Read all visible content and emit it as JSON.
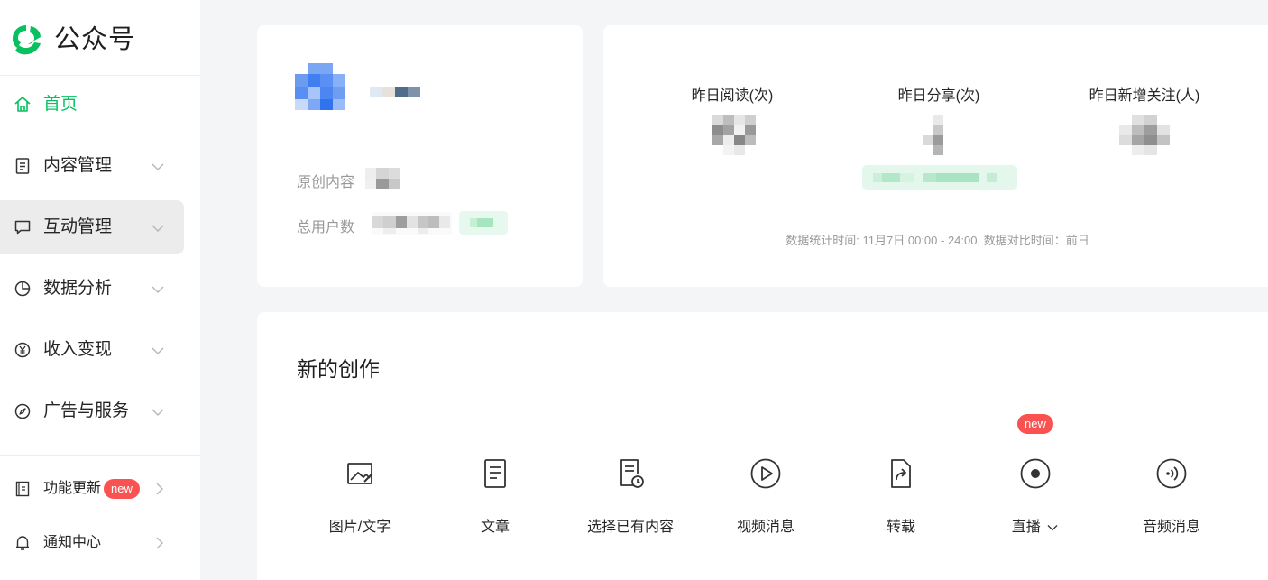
{
  "app": {
    "title": "公众号"
  },
  "sidebar": {
    "items": [
      {
        "label": "首页",
        "icon": "home-icon",
        "active": true
      },
      {
        "label": "内容管理",
        "icon": "document-icon"
      },
      {
        "label": "互动管理",
        "icon": "chat-icon"
      },
      {
        "label": "数据分析",
        "icon": "pie-chart-icon"
      },
      {
        "label": "收入变现",
        "icon": "yen-icon"
      },
      {
        "label": "广告与服务",
        "icon": "compass-icon"
      }
    ],
    "bottom": [
      {
        "label": "功能更新",
        "badge": "new",
        "icon": "update-book-icon"
      },
      {
        "label": "通知中心",
        "icon": "bell-icon"
      }
    ]
  },
  "profile": {
    "original_label": "原创内容",
    "users_label": "总用户数"
  },
  "stats": {
    "read_label": "昨日阅读(次)",
    "share_label": "昨日分享(次)",
    "follow_label": "昨日新增关注(人)",
    "footnote": "数据统计时间: 11月7日 00:00 - 24:00, 数据对比时间：前日"
  },
  "create": {
    "title": "新的创作",
    "tools": [
      {
        "label": "图片/文字",
        "icon": "image-text-icon"
      },
      {
        "label": "文章",
        "icon": "article-icon"
      },
      {
        "label": "选择已有内容",
        "icon": "existing-content-icon"
      },
      {
        "label": "视频消息",
        "icon": "video-play-icon"
      },
      {
        "label": "转载",
        "icon": "repost-icon"
      },
      {
        "label": "直播",
        "icon": "live-icon",
        "badge": "new",
        "has_dropdown": true
      },
      {
        "label": "音频消息",
        "icon": "audio-icon"
      }
    ]
  },
  "colors": {
    "brand": "#07c160",
    "badge": "#fa5151"
  }
}
